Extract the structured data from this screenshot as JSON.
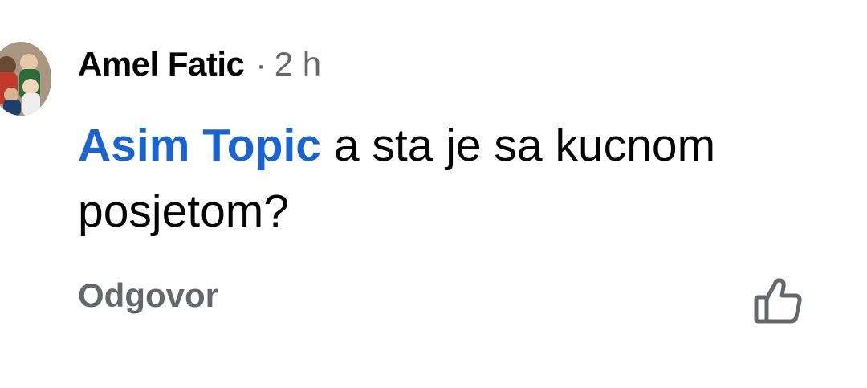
{
  "comment": {
    "author": "Amel Fatic",
    "separator": "·",
    "time": "2 h",
    "mention": "Asim Topic",
    "text": " a sta je sa kucnom posjetom?",
    "reply_label": "Odgovor"
  },
  "icons": {
    "avatar": "avatar-photo",
    "like": "thumbs-up-icon"
  },
  "colors": {
    "mention": "#1a64d1",
    "secondary": "#65676b",
    "primary": "#050505"
  }
}
